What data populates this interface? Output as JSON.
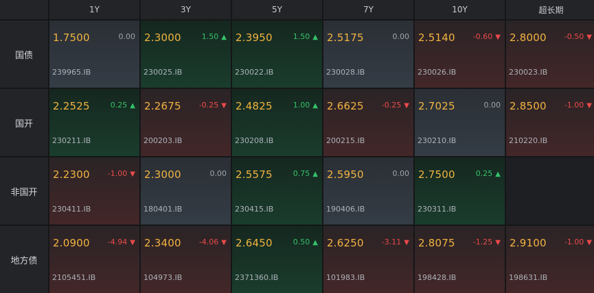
{
  "columns": [
    "1Y",
    "3Y",
    "5Y",
    "7Y",
    "10Y",
    "超长期"
  ],
  "rows": [
    {
      "label": "国债",
      "cells": [
        {
          "price": "1.7500",
          "change": "0.00",
          "dir": "neutral",
          "code": "239965.IB"
        },
        {
          "price": "2.3000",
          "change": "1.50",
          "dir": "up",
          "code": "230025.IB"
        },
        {
          "price": "2.3950",
          "change": "1.50",
          "dir": "up",
          "code": "230022.IB"
        },
        {
          "price": "2.5175",
          "change": "0.00",
          "dir": "neutral",
          "code": "230028.IB"
        },
        {
          "price": "2.5140",
          "change": "-0.60",
          "dir": "down",
          "code": "230026.IB"
        },
        {
          "price": "2.8000",
          "change": "-0.50",
          "dir": "down",
          "code": "230023.IB"
        }
      ]
    },
    {
      "label": "国开",
      "cells": [
        {
          "price": "2.2525",
          "change": "0.25",
          "dir": "up",
          "code": "230211.IB"
        },
        {
          "price": "2.2675",
          "change": "-0.25",
          "dir": "down",
          "code": "200203.IB"
        },
        {
          "price": "2.4825",
          "change": "1.00",
          "dir": "up",
          "code": "230208.IB"
        },
        {
          "price": "2.6625",
          "change": "-0.25",
          "dir": "down",
          "code": "200215.IB"
        },
        {
          "price": "2.7025",
          "change": "0.00",
          "dir": "neutral",
          "code": "230210.IB"
        },
        {
          "price": "2.8500",
          "change": "-1.00",
          "dir": "down",
          "code": "210220.IB"
        }
      ]
    },
    {
      "label": "非国开",
      "cells": [
        {
          "price": "2.2300",
          "change": "-1.00",
          "dir": "down",
          "code": "230411.IB"
        },
        {
          "price": "2.3000",
          "change": "0.00",
          "dir": "neutral",
          "code": "180401.IB"
        },
        {
          "price": "2.5575",
          "change": "0.75",
          "dir": "up",
          "code": "230415.IB"
        },
        {
          "price": "2.5950",
          "change": "0.00",
          "dir": "neutral",
          "code": "190406.IB"
        },
        {
          "price": "2.7500",
          "change": "0.25",
          "dir": "up",
          "code": "230311.IB"
        },
        null
      ]
    },
    {
      "label": "地方债",
      "cells": [
        {
          "price": "2.0900",
          "change": "-4.94",
          "dir": "down",
          "code": "2105451.IB"
        },
        {
          "price": "2.3400",
          "change": "-4.06",
          "dir": "down",
          "code": "104973.IB"
        },
        {
          "price": "2.6450",
          "change": "0.50",
          "dir": "up",
          "code": "2371360.IB"
        },
        {
          "price": "2.6250",
          "change": "-3.11",
          "dir": "down",
          "code": "101983.IB"
        },
        {
          "price": "2.8075",
          "change": "-1.25",
          "dir": "down",
          "code": "198428.IB"
        },
        {
          "price": "2.9100",
          "change": "-1.00",
          "dir": "down",
          "code": "198631.IB"
        }
      ]
    }
  ],
  "colors": {
    "price": "#f2b441",
    "up": "#35c26b",
    "down": "#ec4a4a",
    "neutral": "#9ea3aa"
  }
}
